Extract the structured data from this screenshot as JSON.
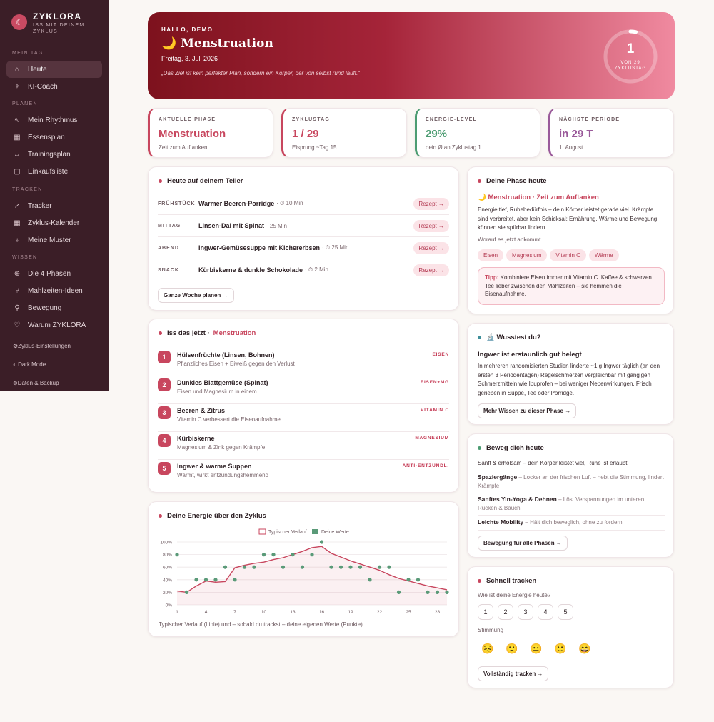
{
  "brand": {
    "name": "ZYKLORA",
    "tagline": "Iss mit deinem Zyklus"
  },
  "nav": {
    "sections": [
      {
        "label": "Mein Tag",
        "items": [
          {
            "label": "Heute",
            "icon": "home-icon"
          },
          {
            "label": "KI-Coach",
            "icon": "sparkle-icon"
          }
        ]
      },
      {
        "label": "Planen",
        "items": [
          {
            "label": "Mein Rhythmus",
            "icon": "pulse-icon"
          },
          {
            "label": "Essensplan",
            "icon": "calendar-icon"
          },
          {
            "label": "Trainingsplan",
            "icon": "dumbbell-icon"
          },
          {
            "label": "Einkaufsliste",
            "icon": "bag-icon"
          }
        ]
      },
      {
        "label": "Tracken",
        "items": [
          {
            "label": "Tracker",
            "icon": "chart-icon"
          },
          {
            "label": "Zyklus-Kalender",
            "icon": "calendar-icon"
          },
          {
            "label": "Meine Muster",
            "icon": "bulb-icon"
          }
        ]
      },
      {
        "label": "Wissen",
        "items": [
          {
            "label": "Die 4 Phasen",
            "icon": "globe-icon"
          },
          {
            "label": "Mahlzeiten-Ideen",
            "icon": "fork-icon"
          },
          {
            "label": "Bewegung",
            "icon": "run-icon"
          },
          {
            "label": "Warum ZYKLORA",
            "icon": "heart-icon"
          }
        ]
      }
    ],
    "bottom": [
      {
        "label": "Zyklus-Einstellungen",
        "icon": "gear-icon"
      },
      {
        "label": "Dark Mode",
        "icon": "moon-icon"
      },
      {
        "label": "Daten & Backup",
        "icon": "lock-icon"
      }
    ]
  },
  "hero": {
    "greeting": "HALLO, DEMO",
    "title": "🌙 Menstruation",
    "date": "Freitag, 3. Juli 2026",
    "quote": "„Das Ziel ist kein perfekter Plan, sondern ein Körper, der von selbst rund läuft.“",
    "cycle_day": "1",
    "cycle_label_1": "von 29",
    "cycle_label_2": "Zyklustag",
    "progress": 0.0345
  },
  "stats": [
    {
      "label": "Aktuelle Phase",
      "value": "Menstruation",
      "sub": "Zeit zum Auftanken",
      "color": "#c8465e"
    },
    {
      "label": "Zyklustag",
      "value": "1 / 29",
      "sub": "Eisprung ~Tag 15",
      "color": "#c8465e"
    },
    {
      "label": "Energie-Level",
      "value": "29%",
      "sub": "dein Ø an Zyklustag 1",
      "color": "#4c9c72"
    },
    {
      "label": "Nächste Periode",
      "value": "in 29 T",
      "sub": "1. August",
      "color": "#9a5a9a"
    }
  ],
  "plate": {
    "title": "Heute auf deinem Teller",
    "meals": [
      {
        "time": "FRÜHSTÜCK",
        "name": "Warmer Beeren-Porridge",
        "minutes": "· ⏱ 10 Min",
        "action": "Rezept →"
      },
      {
        "time": "MITTAG",
        "name": "Linsen-Dal mit Spinat",
        "minutes": "· 25 Min",
        "action": "Rezept →"
      },
      {
        "time": "ABEND",
        "name": "Ingwer-Gemüsesuppe mit Kichererbsen",
        "minutes": "· ⏱ 25 Min",
        "action": "Rezept →"
      },
      {
        "time": "SNACK",
        "name": "Kürbiskerne & dunkle Schokolade",
        "minutes": "· ⏱ 2 Min",
        "action": "Rezept →"
      }
    ],
    "week_button": "Ganze Woche planen →"
  },
  "eat": {
    "title": "Iss das jetzt ·",
    "phase": "Menstruation",
    "items": [
      {
        "num": "1",
        "name": "Hülsenfrüchte (Linsen, Bohnen)",
        "desc": "Pflanzliches Eisen + Eiweiß gegen den Verlust",
        "tag": "EISEN"
      },
      {
        "num": "2",
        "name": "Dunkles Blattgemüse (Spinat)",
        "desc": "Eisen und Magnesium in einem",
        "tag": "EISEN+MG"
      },
      {
        "num": "3",
        "name": "Beeren & Zitrus",
        "desc": "Vitamin C verbessert die Eisenaufnahme",
        "tag": "VITAMIN C"
      },
      {
        "num": "4",
        "name": "Kürbiskerne",
        "desc": "Magnesium & Zink gegen Krämpfe",
        "tag": "MAGNESIUM"
      },
      {
        "num": "5",
        "name": "Ingwer & warme Suppen",
        "desc": "Wärmt, wirkt entzündungshemmend",
        "tag": "ANTI-ENTZÜNDL."
      }
    ]
  },
  "energy": {
    "title": "Deine Energie über den Zyklus",
    "caption": "Typischer Verlauf (Linie) und – sobald du trackst – deine eigenen Werte (Punkte)."
  },
  "chart_data": {
    "type": "line",
    "title": "Deine Energie über den Zyklus",
    "xlabel": "",
    "ylabel": "",
    "xlim": [
      1,
      29
    ],
    "ylim": [
      0,
      100
    ],
    "x_ticks": [
      1,
      4,
      7,
      10,
      13,
      16,
      19,
      22,
      25,
      28
    ],
    "y_ticks": [
      "0%",
      "20%",
      "40%",
      "60%",
      "80%",
      "100%"
    ],
    "legend_position": "top-center",
    "grid": true,
    "series": [
      {
        "name": "Typischer Verlauf",
        "kind": "line",
        "color": "#c8465e",
        "x": [
          1,
          2,
          3,
          4,
          5,
          6,
          7,
          8,
          9,
          10,
          11,
          12,
          13,
          14,
          15,
          16,
          17,
          18,
          19,
          20,
          21,
          22,
          23,
          24,
          25,
          26,
          27,
          28,
          29
        ],
        "y": [
          22,
          20,
          30,
          38,
          36,
          37,
          59,
          63,
          66,
          68,
          72,
          75,
          80,
          85,
          91,
          93,
          82,
          76,
          70,
          65,
          60,
          55,
          48,
          42,
          38,
          34,
          30,
          27,
          24
        ]
      },
      {
        "name": "Deine Werte",
        "kind": "scatter",
        "color": "#5a9a78",
        "x": [
          1,
          2,
          3,
          4,
          5,
          6,
          7,
          8,
          9,
          10,
          11,
          12,
          13,
          14,
          15,
          16,
          17,
          18,
          19,
          20,
          21,
          22,
          23,
          24,
          25,
          26,
          27,
          28,
          29
        ],
        "y": [
          80,
          20,
          40,
          40,
          40,
          60,
          40,
          60,
          60,
          80,
          80,
          60,
          80,
          60,
          80,
          100,
          60,
          60,
          60,
          60,
          40,
          60,
          60,
          20,
          40,
          40,
          20,
          20,
          20
        ]
      }
    ]
  },
  "phase_today": {
    "title": "Deine Phase heute",
    "heading": "🌙 Menstruation · Zeit zum Auftanken",
    "text": "Energie tief, Ruhebedürfnis – dein Körper leistet gerade viel. Krämpfe sind verbreitet, aber kein Schicksal: Ernährung, Wärme und Bewegung können sie spürbar lindern.",
    "focus_label": "Worauf es jetzt ankommt",
    "chips": [
      "Eisen",
      "Magnesium",
      "Vitamin C",
      "Wärme"
    ],
    "tip_label": "Tipp:",
    "tip_text": " Kombiniere Eisen immer mit Vitamin C. Kaffee & schwarzen Tee lieber zwischen den Mahlzeiten – sie hemmen die Eisenaufnahme."
  },
  "did_you_know": {
    "title": "🔬 Wusstest du?",
    "heading": "Ingwer ist erstaunlich gut belegt",
    "text": "In mehreren randomisierten Studien linderte ~1 g Ingwer täglich (an den ersten 3 Periodentagen) Regelschmerzen vergleichbar mit gängigen Schmerzmitteln wie Ibuprofen – bei weniger Nebenwirkungen. Frisch gerieben in Suppe, Tee oder Porridge.",
    "button": "Mehr Wissen zu dieser Phase →"
  },
  "move": {
    "title": "Beweg dich heute",
    "intro": "Sanft & erholsam – dein Körper leistet viel, Ruhe ist erlaubt.",
    "items": [
      {
        "name": "Spaziergänge",
        "desc": " – Locker an der frischen Luft – hebt die Stimmung, lindert Krämpfe"
      },
      {
        "name": "Sanftes Yin-Yoga & Dehnen",
        "desc": " – Löst Verspannungen im unteren Rücken & Bauch"
      },
      {
        "name": "Leichte Mobility",
        "desc": " – Hält dich beweglich, ohne zu fordern"
      }
    ],
    "button": "Bewegung für alle Phasen →"
  },
  "quick": {
    "title": "Schnell tracken",
    "energy_q": "Wie ist deine Energie heute?",
    "scores": [
      "1",
      "2",
      "3",
      "4",
      "5"
    ],
    "mood_label": "Stimmung",
    "moods": [
      "😣",
      "🙁",
      "😐",
      "🙂",
      "😄"
    ],
    "button": "Vollständig tracken →"
  }
}
